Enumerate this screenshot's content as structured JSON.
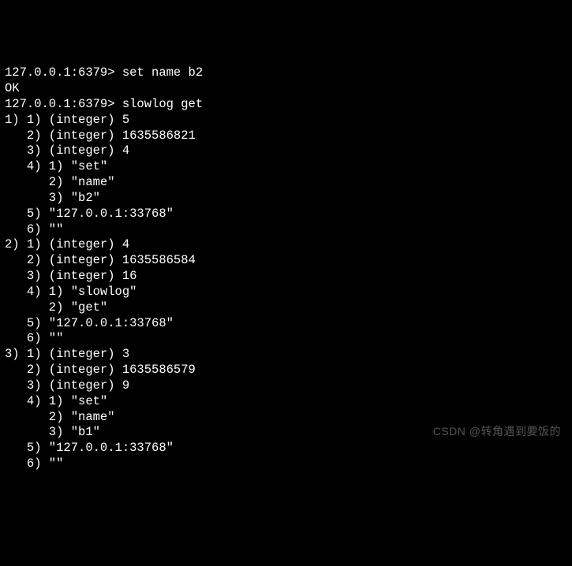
{
  "terminal": {
    "lines": [
      "127.0.0.1:6379> set name b2",
      "OK",
      "127.0.0.1:6379> slowlog get",
      "1) 1) (integer) 5",
      "   2) (integer) 1635586821",
      "   3) (integer) 4",
      "   4) 1) \"set\"",
      "      2) \"name\"",
      "      3) \"b2\"",
      "   5) \"127.0.0.1:33768\"",
      "   6) \"\"",
      "2) 1) (integer) 4",
      "   2) (integer) 1635586584",
      "   3) (integer) 16",
      "   4) 1) \"slowlog\"",
      "      2) \"get\"",
      "   5) \"127.0.0.1:33768\"",
      "   6) \"\"",
      "3) 1) (integer) 3",
      "   2) (integer) 1635586579",
      "   3) (integer) 9",
      "   4) 1) \"set\"",
      "      2) \"name\"",
      "      3) \"b1\"",
      "   5) \"127.0.0.1:33768\"",
      "   6) \"\""
    ]
  },
  "watermark": {
    "text": "CSDN @转角遇到要饭的"
  }
}
